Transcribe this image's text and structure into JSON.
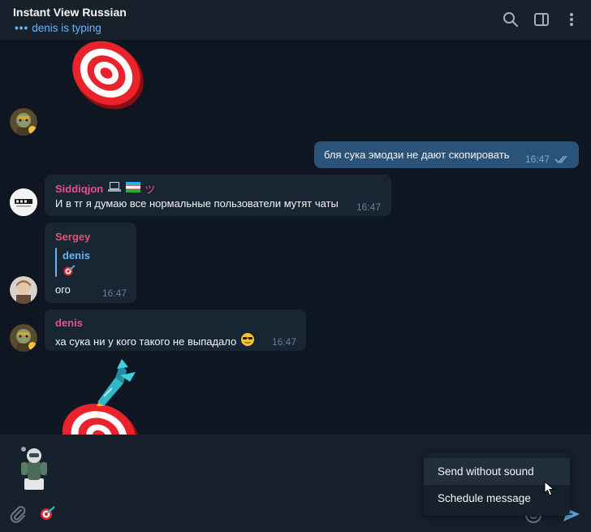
{
  "header": {
    "title": "Instant View Russian",
    "status": "denis is typing",
    "icons": [
      "search-icon",
      "sidebar-toggle-icon",
      "more-vertical-icon"
    ]
  },
  "messages": {
    "outgoing": {
      "text": "бля сука эмодзи не дают скопировать",
      "time": "16:47"
    },
    "siddiqjon": {
      "sender": "Siddiqjon",
      "sender_color": "#e6518b",
      "text": "И в тг я думаю все нормальные пользователи мутят чаты",
      "time": "16:47"
    },
    "sergey": {
      "sender": "Sergey",
      "sender_color": "#e5556f",
      "reply_name": "denis",
      "text": "ого",
      "time": "16:47"
    },
    "denis": {
      "sender": "denis",
      "sender_color": "#e6518b",
      "text": "ха сука ни у кого такого не выпадало",
      "time": "16:47"
    }
  },
  "context_menu": {
    "items": [
      "Send without sound",
      "Schedule message"
    ]
  },
  "colors": {
    "background": "#0e1621",
    "panel": "#17212b",
    "bubble_in": "#182533",
    "bubble_out": "#2b5278",
    "accent": "#6ab3f3"
  }
}
